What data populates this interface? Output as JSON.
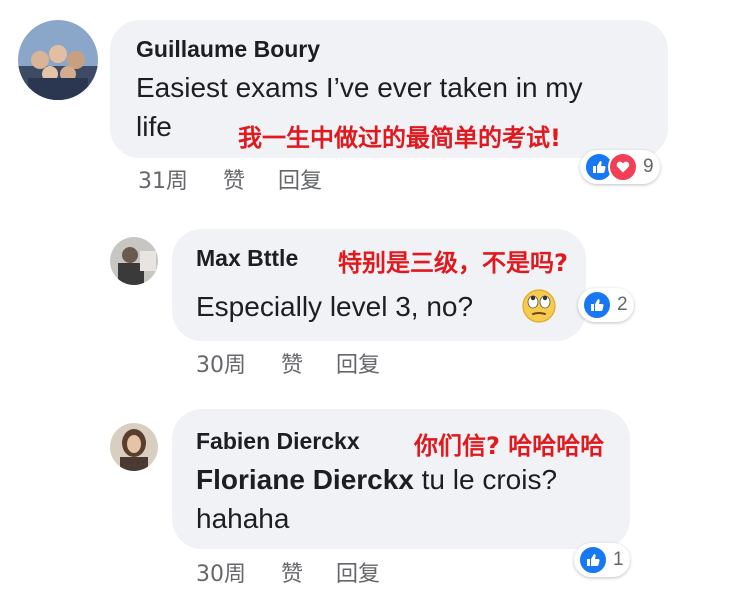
{
  "comments": [
    {
      "author": "Guillaume Boury",
      "text_line1": "Easiest exams I’ve ever taken in my",
      "text_line2": "life",
      "translation": "我一生中做过的最简单的考试!",
      "time": "31周",
      "like_label": "赞",
      "reply_label": "回复",
      "reaction_count": "9",
      "reactions": [
        "like-icon",
        "heart-icon"
      ]
    },
    {
      "author": "Max Bttle",
      "text": "Especially level 3, no?",
      "emoji": "eye-roll-emoji",
      "translation": "特别是三级，不是吗?",
      "time": "30周",
      "like_label": "赞",
      "reply_label": "回复",
      "reaction_count": "2",
      "reactions": [
        "like-icon"
      ]
    },
    {
      "author": "Fabien Dierckx",
      "mention": "Floriane Dierckx",
      "text_line1_rest": " tu le crois?",
      "text_line2": "hahaha",
      "translation": "你们信? 哈哈哈哈",
      "time": "30周",
      "like_label": "赞",
      "reply_label": "回复",
      "reaction_count": "1",
      "reactions": [
        "like-icon"
      ]
    }
  ],
  "colors": {
    "bubble": "#f0f2f5",
    "like_blue": "#1877f2",
    "love_red": "#f33e58",
    "translation_red": "#e0191f",
    "meta_gray": "#65676b"
  }
}
